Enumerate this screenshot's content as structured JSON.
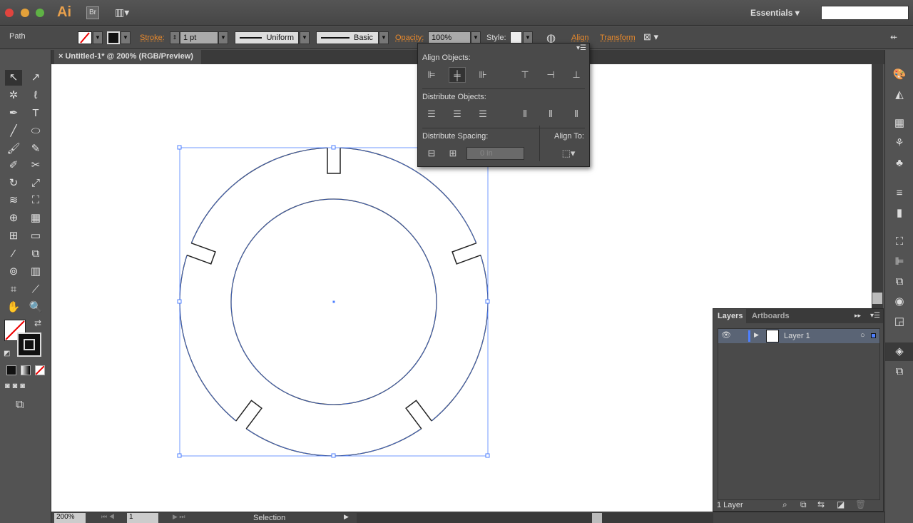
{
  "app": {
    "logo": "Ai",
    "bridge": "Br",
    "workspace": "Essentials",
    "search_placeholder": ""
  },
  "control_bar": {
    "selection_type": "Path",
    "stroke_label": "Stroke:",
    "stroke_weight": "1 pt",
    "profile": "Uniform",
    "brush": "Basic",
    "opacity_label": "Opacity:",
    "opacity": "100%",
    "style_label": "Style:",
    "align_link": "Align",
    "transform_link": "Transform"
  },
  "document": {
    "tab_title": "Untitled-1* @ 200% (RGB/Preview)"
  },
  "align_panel": {
    "align_objects": "Align Objects:",
    "distribute_objects": "Distribute Objects:",
    "distribute_spacing": "Distribute Spacing:",
    "align_to": "Align To:",
    "spacing_value": "0 in"
  },
  "layers_panel": {
    "tabs": [
      "Layers",
      "Artboards"
    ],
    "active_tab": "Layers",
    "layers": [
      {
        "name": "Layer 1",
        "visible": true,
        "color": "#4d7fff"
      }
    ],
    "count": "1 Layer"
  },
  "status_bar": {
    "zoom": "200%",
    "artboard": "1",
    "tool": "Selection"
  },
  "colors": {
    "accent": "#e8892c",
    "selection": "#4d7fff"
  }
}
